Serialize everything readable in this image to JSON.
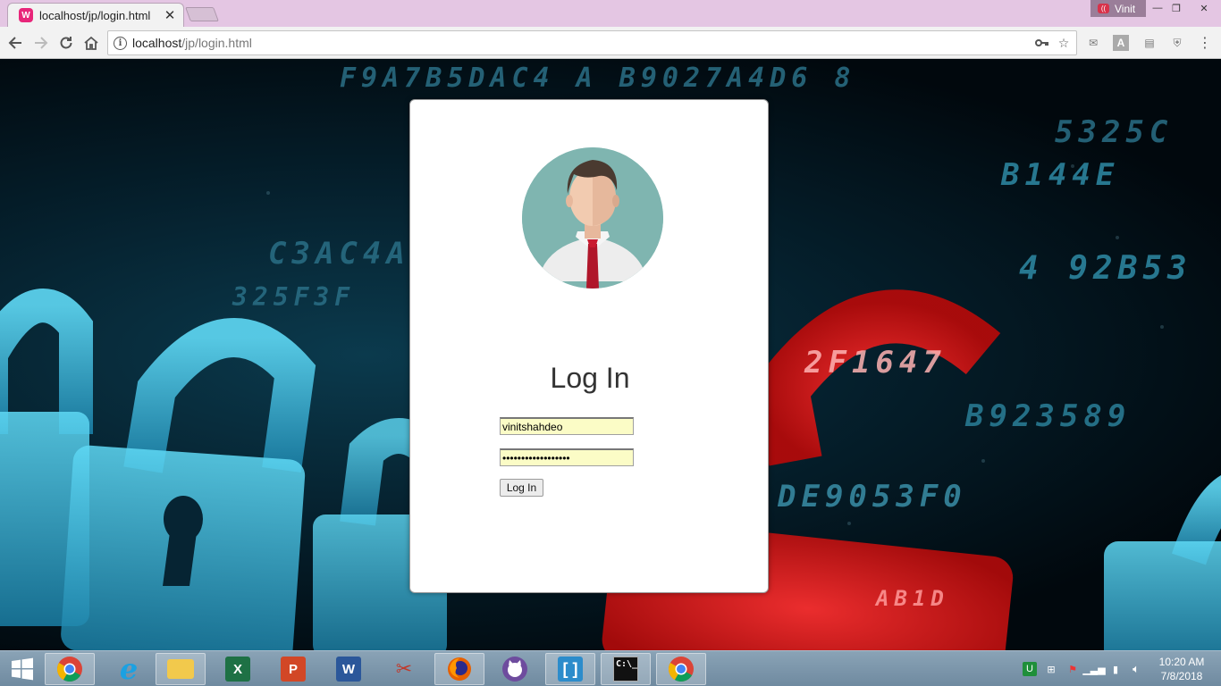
{
  "browser": {
    "tab_title": "localhost/jp/login.html",
    "profile_name": "Vinit",
    "url_host": "localhost",
    "url_path": "/jp/login.html"
  },
  "page": {
    "login_title": "Log In",
    "username_value": "vinitshahdeo",
    "password_value": "••••••••••••••••••",
    "login_button_label": "Log In"
  },
  "taskbar": {
    "apps": [
      "chrome",
      "internet-explorer",
      "file-explorer",
      "excel",
      "powerpoint",
      "word",
      "snipping-tool",
      "firefox",
      "github-desktop",
      "brackets",
      "command-prompt",
      "chrome"
    ],
    "time": "10:20 AM",
    "date": "7/8/2018"
  },
  "colors": {
    "titlebar": "#e4c6e3",
    "favicon": "#e8267a",
    "field_bg": "#fbfcc6",
    "lock_blue": "#2fb6d8",
    "lock_red": "#e0161c"
  }
}
